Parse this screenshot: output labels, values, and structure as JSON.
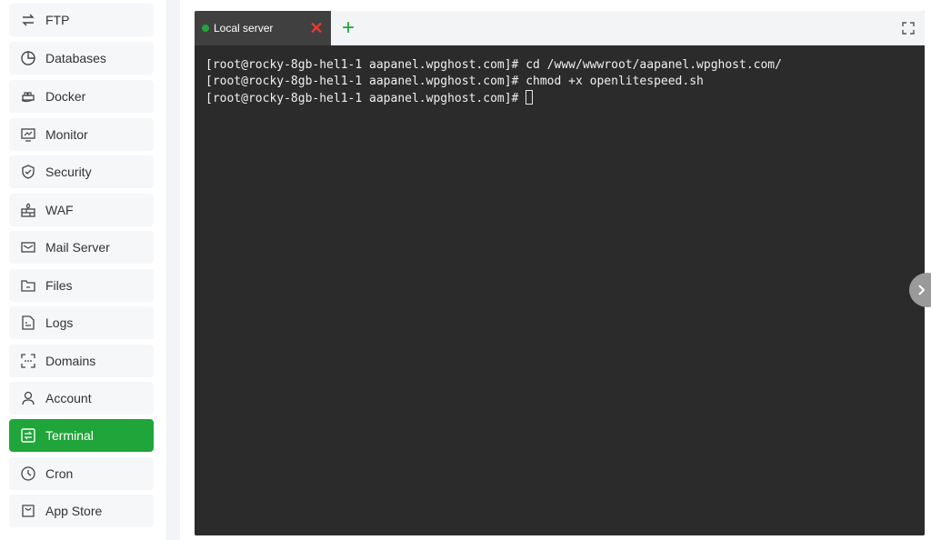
{
  "sidebar": {
    "items": [
      {
        "label": "FTP",
        "icon": "ftp-icon"
      },
      {
        "label": "Databases",
        "icon": "database-icon"
      },
      {
        "label": "Docker",
        "icon": "docker-icon"
      },
      {
        "label": "Monitor",
        "icon": "monitor-icon"
      },
      {
        "label": "Security",
        "icon": "shield-icon"
      },
      {
        "label": "WAF",
        "icon": "firewall-icon"
      },
      {
        "label": "Mail Server",
        "icon": "mail-icon"
      },
      {
        "label": "Files",
        "icon": "folder-icon"
      },
      {
        "label": "Logs",
        "icon": "log-icon"
      },
      {
        "label": "Domains",
        "icon": "domain-icon"
      },
      {
        "label": "Account",
        "icon": "user-icon"
      },
      {
        "label": "Terminal",
        "icon": "terminal-icon",
        "active": true
      },
      {
        "label": "Cron",
        "icon": "clock-icon"
      },
      {
        "label": "App Store",
        "icon": "store-icon"
      }
    ]
  },
  "terminal": {
    "tab_label": "Local server",
    "lines": [
      "[root@rocky-8gb-hel1-1 aapanel.wpghost.com]# cd /www/wwwroot/aapanel.wpghost.com/",
      "[root@rocky-8gb-hel1-1 aapanel.wpghost.com]# chmod +x openlitespeed.sh",
      "[root@rocky-8gb-hel1-1 aapanel.wpghost.com]# "
    ]
  },
  "colors": {
    "accent": "#20a53a",
    "terminal_bg": "#2b2b2b",
    "close": "#e53935"
  }
}
